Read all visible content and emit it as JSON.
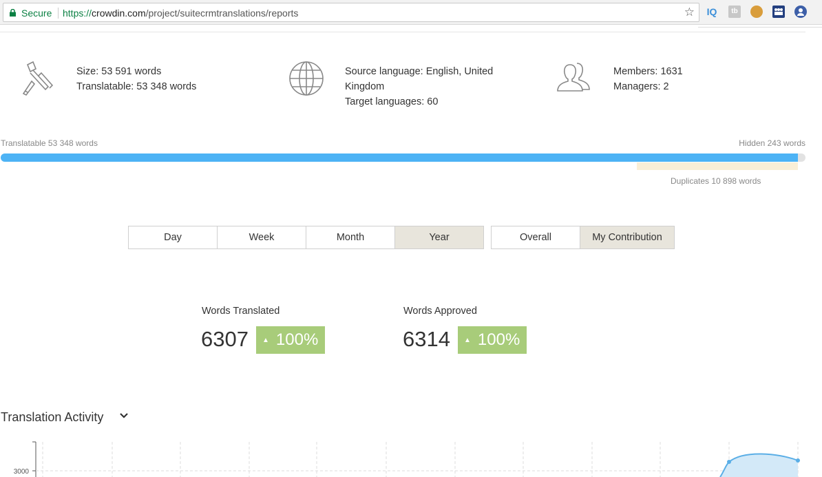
{
  "browser": {
    "secure_label": "Secure",
    "url_scheme": "https://",
    "url_host": "crowdin.com",
    "url_path": "/project/suitecrmtranslations/reports",
    "extensions": [
      "IQ",
      "tb",
      "cookie-icon",
      "group-icon",
      "avatar-icon"
    ]
  },
  "stats": {
    "size": "Size: 53 591 words",
    "translatable": "Translatable: 53 348 words",
    "source_language_line1": "Source language: English, United",
    "source_language_line2": "Kingdom",
    "target_languages": "Target languages: 60",
    "members": "Members: 1631",
    "managers": "Managers: 2"
  },
  "progress": {
    "left_label": "Translatable 53 348 words",
    "right_label": "Hidden 243 words",
    "duplicates_label": "Duplicates 10 898 words",
    "fill_fraction": 0.991,
    "colors": {
      "fill": "#4db3f5",
      "track": "#e2e2e2",
      "duplicates": "#faefd7"
    }
  },
  "period_tabs": [
    {
      "label": "Day",
      "active": false
    },
    {
      "label": "Week",
      "active": false
    },
    {
      "label": "Month",
      "active": false
    },
    {
      "label": "Year",
      "active": true
    }
  ],
  "scope_tabs": [
    {
      "label": "Overall",
      "active": false
    },
    {
      "label": "My Contribution",
      "active": true
    }
  ],
  "counters": {
    "translated": {
      "label": "Words Translated",
      "value": "6307",
      "change": "100%"
    },
    "approved": {
      "label": "Words Approved",
      "value": "6314",
      "change": "100%"
    },
    "badge_color": "#a8cc7a"
  },
  "activity": {
    "title": "Translation Activity",
    "y_tick": "3000"
  },
  "chart_data": {
    "type": "area",
    "y_ticks": [
      "3000"
    ],
    "series_color": "#5aaee6"
  }
}
